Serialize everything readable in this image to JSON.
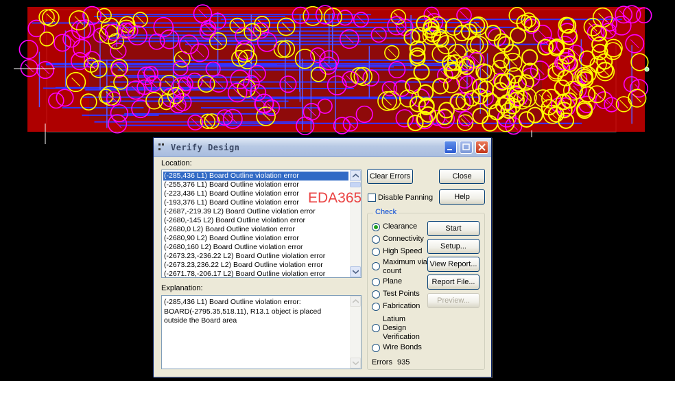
{
  "dialog": {
    "title": "Verify Design",
    "location_label": "Location:",
    "explanation_label": "Explanation:",
    "errors": [
      "(-285,436 L1) Board Outline violation error",
      "(-255,376 L1) Board Outline violation error",
      "(-223,436 L1) Board Outline violation error",
      "(-193,376 L1) Board Outline violation error",
      "(-2687,-219.39 L2) Board Outline violation error",
      "(-2680,-145 L2) Board Outline violation error",
      "(-2680,0 L2) Board Outline violation error",
      "(-2680,90 L2) Board Outline violation error",
      "(-2680,160 L2) Board Outline violation error",
      "(-2673.23,-236.22 L2) Board Outline violation error",
      "(-2673.23,236.22 L2) Board Outline violation error",
      "(-2671.78,-206.17 L2) Board Outline violation error"
    ],
    "selected_error_index": 0,
    "explanation_lines": [
      "(-285,436 L1) Board Outline violation error:",
      "BOARD(-2795.35,518.11), R13.1 object is placed",
      "outside the Board area"
    ],
    "buttons": {
      "clear_errors": "Clear Errors",
      "close": "Close",
      "help": "Help",
      "start": "Start",
      "setup": "Setup...",
      "view_report": "View Report...",
      "report_file": "Report File...",
      "preview": "Preview..."
    },
    "disable_panning": {
      "label": "Disable Panning",
      "checked": false
    },
    "check_group": {
      "title": "Check",
      "options": [
        "Clearance",
        "Connectivity",
        "High Speed",
        "Maximum via count",
        "Plane",
        "Test Points",
        "Fabrication",
        "Latium Design Verification",
        "Wire Bonds"
      ],
      "selected": "Clearance"
    },
    "errors_label": "Errors",
    "errors_count": "935"
  },
  "watermark": "EDA365",
  "colors": {
    "board_red": "#cc0000",
    "trace_blue": "#3333ff",
    "marker_magenta": "#ff00ff",
    "marker_yellow": "#ffff00",
    "dialog_face": "#ece9d8",
    "selection": "#316ac5"
  }
}
